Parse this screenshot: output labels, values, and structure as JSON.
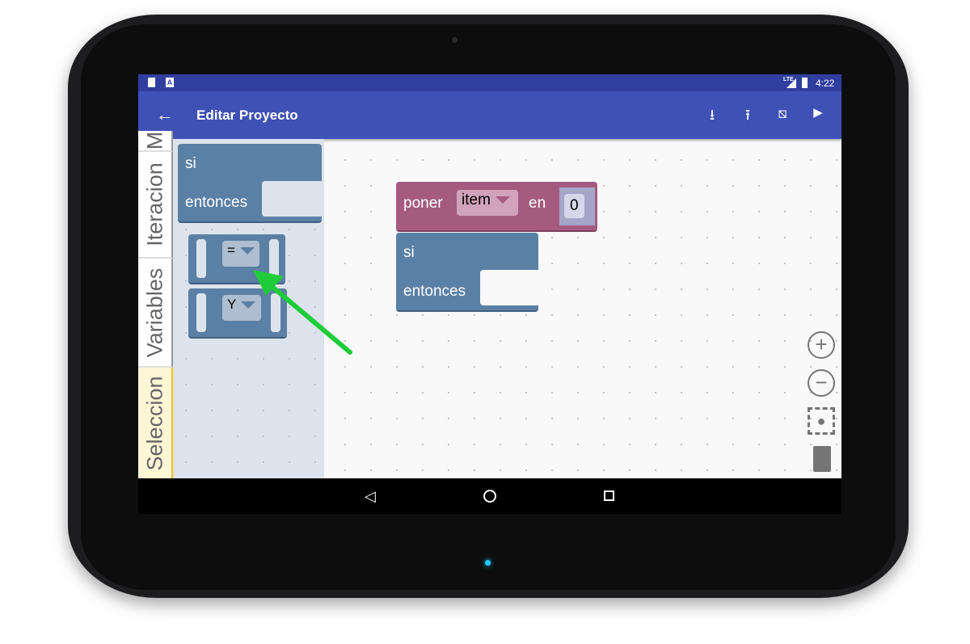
{
  "status_bar": {
    "time": "4:22",
    "network": "LTE",
    "icons": [
      "sd-card-icon",
      "a-notification-icon",
      "signal-icon",
      "battery-icon"
    ]
  },
  "app_bar": {
    "title": "Editar Proyecto",
    "actions": [
      "back-arrow-icon",
      "download-icon",
      "upload-icon",
      "clear-layers-icon",
      "play-icon"
    ]
  },
  "categories": [
    {
      "label": "M"
    },
    {
      "label": "Iteracion"
    },
    {
      "label": "Variables"
    },
    {
      "label": "Seleccion",
      "selected": true
    }
  ],
  "flyout": {
    "if_block": {
      "if_label": "si",
      "then_label": "entonces"
    },
    "compare_block": {
      "operator": "="
    },
    "logic_block": {
      "operator": "Y"
    }
  },
  "workspace": {
    "set_block": {
      "label": "poner",
      "variable": "item",
      "in_label": "en",
      "value": "0"
    },
    "if_block": {
      "if_label": "si",
      "then_label": "entonces"
    }
  },
  "colors": {
    "logic_block": "#5b80a5",
    "variable_block": "#a55b80",
    "annotation_arrow": "#1ecc3a",
    "selected_tab": "#ffc107"
  },
  "zoom_controls": [
    "zoom-in-icon",
    "zoom-out-icon",
    "recenter-icon",
    "trash-icon"
  ],
  "nav_bar": [
    "back-triangle-icon",
    "home-circle-icon",
    "recents-square-icon"
  ]
}
